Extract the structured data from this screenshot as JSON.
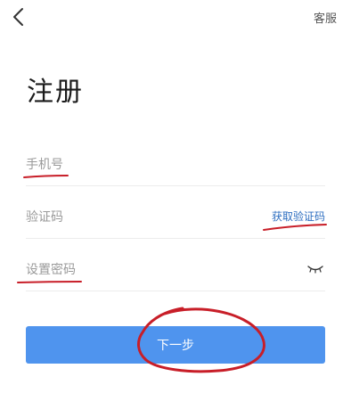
{
  "header": {
    "back_icon": "chevron-left-icon",
    "service_label": "客服"
  },
  "page": {
    "title": "注册"
  },
  "form": {
    "phone_placeholder": "手机号",
    "code_placeholder": "验证码",
    "get_code_label": "获取验证码",
    "password_placeholder": "设置密码",
    "password_toggle_icon": "eye-closed-icon",
    "next_label": "下一步"
  },
  "colors": {
    "primary_button": "#4f94ee",
    "link": "#2d6ec0",
    "annotation": "#c81e28"
  }
}
